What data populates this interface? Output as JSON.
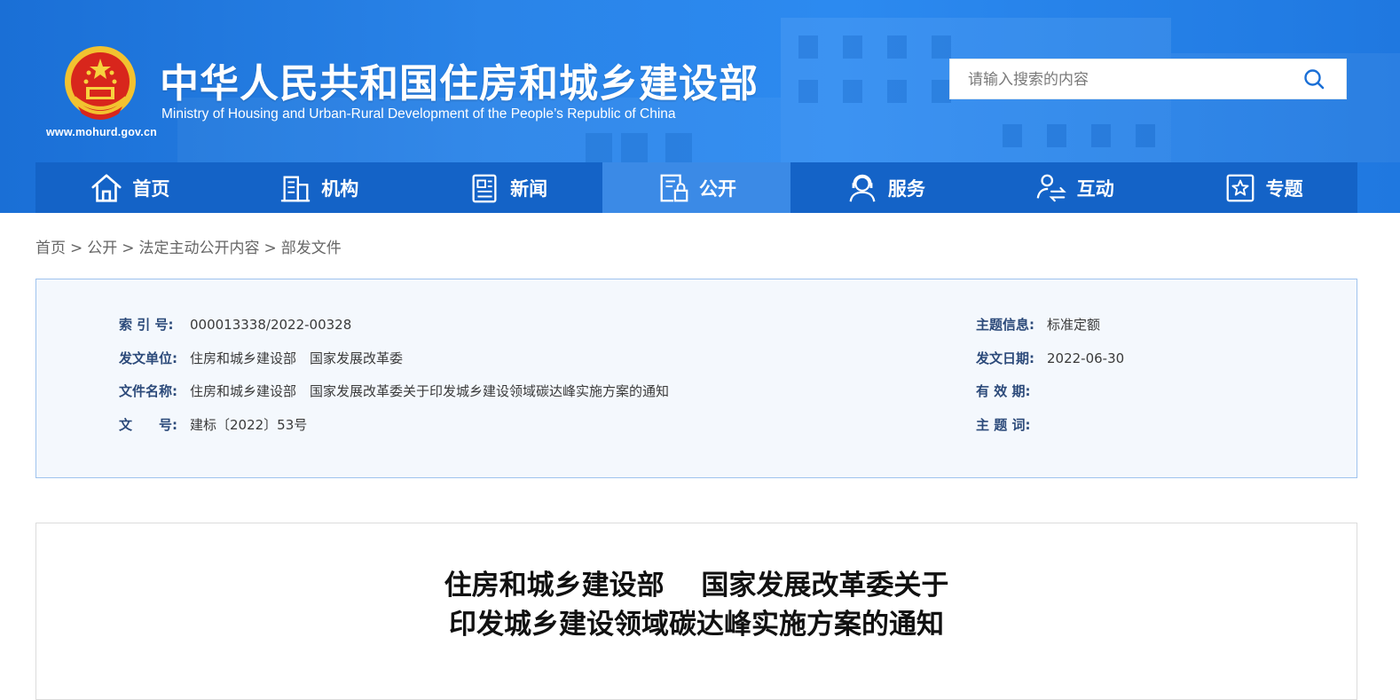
{
  "header": {
    "site_url": "www.mohurd.gov.cn",
    "title_cn": "中华人民共和国住房和城乡建设部",
    "title_en": "Ministry of Housing and Urban-Rural Development of the People’s Republic of China",
    "search_placeholder": "请输入搜索的内容",
    "search_icon": "search-icon"
  },
  "nav": {
    "items": [
      {
        "label": "首页",
        "icon": "home-icon"
      },
      {
        "label": "机构",
        "icon": "building-icon"
      },
      {
        "label": "新闻",
        "icon": "news-icon"
      },
      {
        "label": "公开",
        "icon": "document-lock-icon",
        "active": true
      },
      {
        "label": "服务",
        "icon": "service-person-icon"
      },
      {
        "label": "互动",
        "icon": "interaction-icon"
      },
      {
        "label": "专题",
        "icon": "star-box-icon"
      }
    ]
  },
  "breadcrumb": {
    "items": [
      "首页",
      "公开",
      "法定主动公开内容",
      "部发文件"
    ],
    "separator": ">"
  },
  "info": {
    "index_label": "索 引 号:",
    "index_value": "000013338/2022-00328",
    "issuer_label": "发文单位:",
    "issuer_value": "住房和城乡建设部　国家发展改革委",
    "filename_label": "文件名称:",
    "filename_value": "住房和城乡建设部　国家发展改革委关于印发城乡建设领域碳达峰实施方案的通知",
    "docno_label": "文　　号:",
    "docno_value": "建标〔2022〕53号",
    "topic_label": "主题信息:",
    "topic_value": "标准定额",
    "date_label": "发文日期:",
    "date_value": "2022-06-30",
    "validity_label": "有 效 期:",
    "validity_value": "",
    "keywords_label": "主 题 词:",
    "keywords_value": ""
  },
  "article": {
    "title_line1": "住房和城乡建设部　 国家发展改革委关于",
    "title_line2": "印发城乡建设领域碳达峰实施方案的通知"
  },
  "colors": {
    "header_blue": "#2a84e8",
    "nav_blue": "#1463c7",
    "nav_active": "#3b8ae6",
    "info_bg": "#f4f8fd",
    "info_border": "#9fc3ee",
    "label_color": "#2c4a7a"
  }
}
